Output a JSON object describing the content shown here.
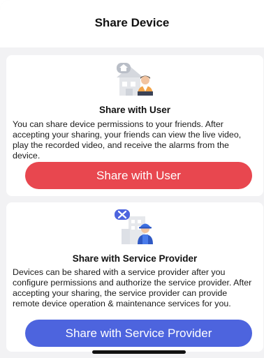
{
  "header": {
    "title": "Share Device"
  },
  "cards": [
    {
      "title": "Share with User",
      "description": "You can share device permissions to your friends. After accepting your sharing, your friends can view the live video, play the recorded video, and receive the alarms from the device.",
      "button_label": "Share with User",
      "button_color": "#e8474f",
      "icon": "house-user-icon"
    },
    {
      "title": "Share with Service Provider",
      "description": "Devices can be shared with a service provider after you configure permissions and authorize the service provider. After accepting your sharing, the service provider can provide remote device operation & maintenance services for you.",
      "button_label": "Share with Service Provider",
      "button_color": "#4d64de",
      "icon": "service-provider-icon"
    }
  ]
}
